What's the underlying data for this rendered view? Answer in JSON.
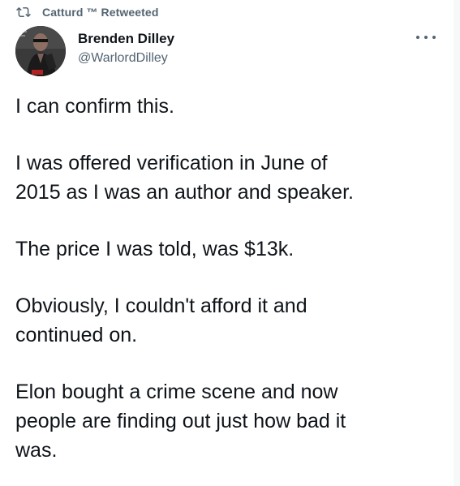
{
  "retweet": {
    "icon": "retweet-icon",
    "text": "Catturd ™ Retweeted"
  },
  "author": {
    "avatar": "avatar",
    "display_name": "Brenden Dilley",
    "handle": "@WarlordDilley"
  },
  "menu": {
    "icon": "more-icon"
  },
  "tweet": {
    "paragraphs": [
      "I can confirm this.",
      "I was offered verification in June of\n2015 as I was an author and speaker.",
      "The price I was told, was $13k.",
      "Obviously, I couldn't afford it and\ncontinued on.",
      "Elon bought a crime scene and now\npeople are finding out just how bad it\nwas."
    ]
  },
  "colors": {
    "text": "#0f1419",
    "muted": "#536471",
    "background": "#ffffff"
  }
}
